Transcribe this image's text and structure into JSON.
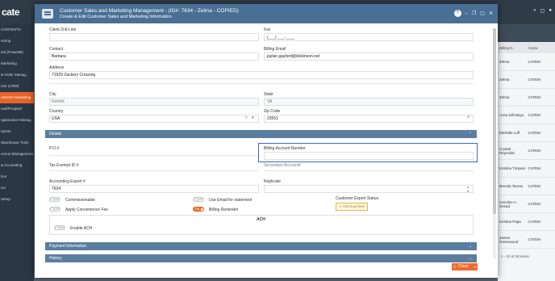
{
  "background": {
    "logo": "cate",
    "sidebar_items": [
      {
        "label": "CONTENTS",
        "active": false
      },
      {
        "label": "eshop",
        "active": false
      },
      {
        "label": "ard (PowerBI)",
        "active": false
      },
      {
        "label": "Marketing",
        "active": false
      },
      {
        "label": "& Order Manag..",
        "active": false
      },
      {
        "label": "mer (CRM)",
        "active": false
      },
      {
        "label": "ustomer Marketing",
        "active": true
      },
      {
        "label": "ead/Prospect",
        "active": false
      },
      {
        "label": "rganization Manag..",
        "active": false
      },
      {
        "label": "eports",
        "active": false
      },
      {
        "label": "Warehouse Tools",
        "active": false
      },
      {
        "label": "venue Management",
        "active": false
      },
      {
        "label": "& Accounting",
        "active": false
      },
      {
        "label": "tion",
        "active": false
      },
      {
        "label": "ver",
        "active": false
      },
      {
        "label": "Setup",
        "active": false
      }
    ],
    "right_panel": {
      "columns": [
        "Billing N.",
        "Custo."
      ],
      "rows": [
        {
          "name": "Zelma",
          "code": "CATEM"
        },
        {
          "name": "Zelma",
          "code": "CATEM"
        },
        {
          "name": "Zelma",
          "code": "CATEM"
        },
        {
          "name": "Anna Dill Mayn.",
          "code": "CATEM"
        },
        {
          "name": "Michelle Luff",
          "code": "CATEM"
        },
        {
          "name": "Crystal Reynolds",
          "code": "CATEM"
        },
        {
          "name": "Kristina Timpani",
          "code": "CATEM"
        },
        {
          "name": "Brenda Tanner",
          "code": "CATEM"
        },
        {
          "name": "Caroline A. Snead",
          "code": "CATEM"
        },
        {
          "name": "Kristina Papa",
          "code": "CATEM"
        },
        {
          "name": "James Greenwood",
          "code": "CATEM"
        }
      ],
      "pager": "1 - 10 of 28 items"
    }
  },
  "modal": {
    "title": "Customer Sales and Marketing Management - (ID#: 7634 - Zelma - COPIED)",
    "subtitle": "Create & Edit Customer Sales and Marketing Information",
    "fields": {
      "client_2nd_line_label": "Client 2nd Line",
      "fax_label": "Fax",
      "fax_value": "(___) ___-____",
      "contact_label": "Contact",
      "contact_value": "Barbara",
      "billing_email_label": "Billing Email",
      "billing_email_value": "jaylan.gaylord@dickinson.net",
      "address_label": "Address",
      "address_value": "71929 Zackery Crossing",
      "city_label": "City",
      "city_value": "Norfolk",
      "state_label": "State",
      "state_value": "VA",
      "country_label": "Country",
      "country_value": "USA",
      "zip_label": "Zip Code",
      "zip_value": "23551"
    },
    "details": {
      "section_label": "Details",
      "po_label": "P.O.#",
      "billing_account_label": "Billing Account Number",
      "tax_exempt_label": "Tax Exempt ID #",
      "secondary_account_label": "Secondary Account#",
      "accounting_export_label": "Accounting Export #",
      "accounting_export_value": "7634",
      "replicate_label": "Replicate",
      "commissionable_label": "Commissionable",
      "use_email_label": "Use Email for statement",
      "customer_export_status_label": "Customer Export Status",
      "not_exported_label": "Not Exported",
      "apply_fee_label": "Apply Convenience Fee",
      "billing_reminder_label": "Billing Reminder",
      "ach_label": "ACH",
      "enable_ach_label": "Enable ACH",
      "toggle_off": "OFF",
      "toggle_on": "ON"
    },
    "sections": {
      "payment_info": "Payment Information",
      "history": "History"
    },
    "footer": {
      "close_label": "Close"
    }
  }
}
